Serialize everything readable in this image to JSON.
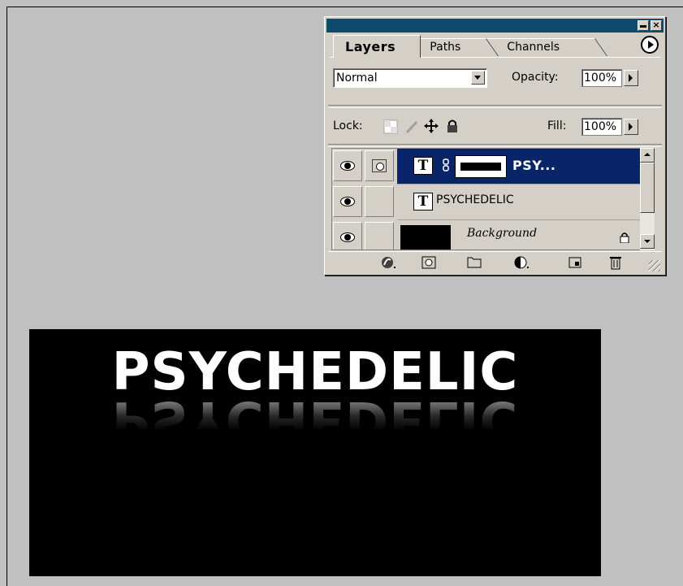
{
  "palette": {
    "tabs": [
      "Layers",
      "Paths",
      "Channels"
    ],
    "blend_mode": "Normal",
    "opacity_label": "Opacity:",
    "opacity_value": "100%",
    "lock_label": "Lock:",
    "fill_label": "Fill:",
    "fill_value": "100%",
    "layers": [
      {
        "name": "PSY...",
        "type": "text",
        "selected": true,
        "has_mask": true
      },
      {
        "name": "PSYCHEDELIC",
        "type": "text",
        "selected": false
      },
      {
        "name": "Background",
        "type": "image",
        "selected": false,
        "locked": true
      }
    ],
    "bottom_icons": [
      "layer-style-icon",
      "add-mask-icon",
      "new-group-icon",
      "adjustment-layer-icon",
      "new-layer-icon",
      "trash-icon"
    ]
  },
  "canvas": {
    "text": "PSYCHEDELIC",
    "reflection_text": "PSYCHEDELIC",
    "background_color": "#000000",
    "text_color": "#ffffff"
  }
}
